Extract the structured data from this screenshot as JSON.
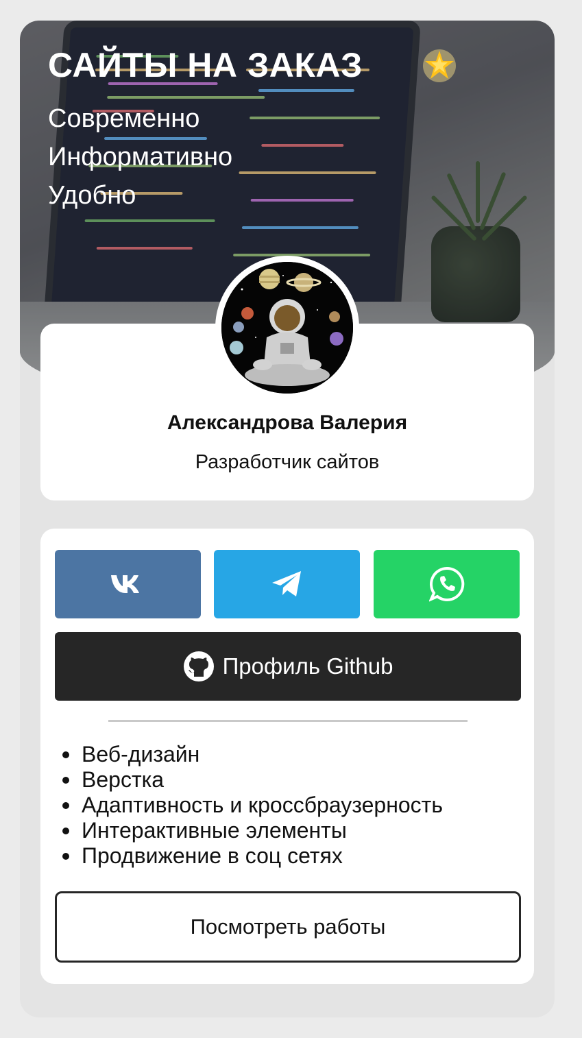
{
  "hero": {
    "title": "САЙТЫ НА ЗАКАЗ",
    "lines": [
      "Современно",
      "Информативно",
      "Удобно"
    ]
  },
  "profile": {
    "name": "Александрова Валерия",
    "role": "Разработчик сайтов"
  },
  "social": {
    "vk_color": "#4c75a3",
    "telegram_color": "#27a6e5",
    "whatsapp_color": "#25d366"
  },
  "github": {
    "label": "Профиль Github"
  },
  "skills": [
    "Веб-дизайн",
    "Верстка",
    "Адаптивность и кроссбраузерность",
    "Интерактивные элементы",
    "Продвижение в соц сетях"
  ],
  "works_button": "Посмотреть работы"
}
